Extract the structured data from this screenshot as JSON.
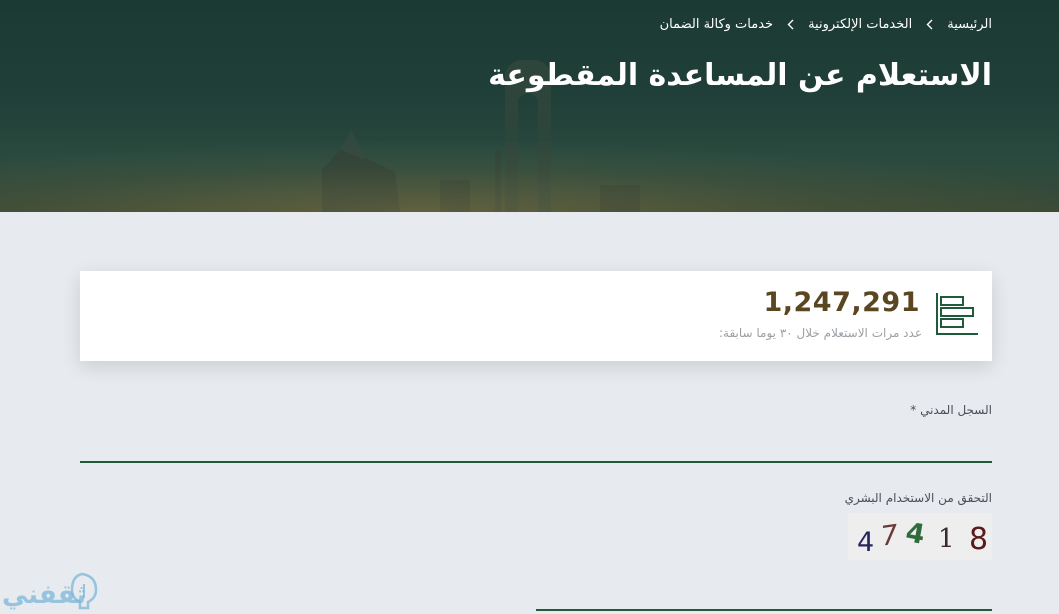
{
  "breadcrumb": {
    "items": [
      {
        "label": "الرئيسية"
      },
      {
        "label": "الخدمات الإلكترونية"
      },
      {
        "label": "خدمات وكالة الضمان"
      }
    ]
  },
  "page": {
    "title": "الاستعلام عن المساعدة المقطوعة"
  },
  "stats": {
    "count": "1,247,291",
    "caption": "عدد مرات الاستعلام خلال ٣٠ يوما سابقة:",
    "icon": "bar-chart-icon"
  },
  "form": {
    "civil_id": {
      "label": "السجل المدني *",
      "value": "",
      "placeholder": ""
    },
    "captcha": {
      "label": "التحقق من الاستخدام البشري",
      "digits": [
        "4",
        "7",
        "4",
        "1",
        "8"
      ],
      "value": ""
    }
  },
  "watermark": {
    "text": "ثقفني",
    "icon": "lightbulb-icon"
  },
  "colors": {
    "hero_bg": "#1f3f38",
    "accent_green": "#1f5a3a",
    "count_brown": "#5a4621",
    "page_bg": "#e7eaee"
  }
}
